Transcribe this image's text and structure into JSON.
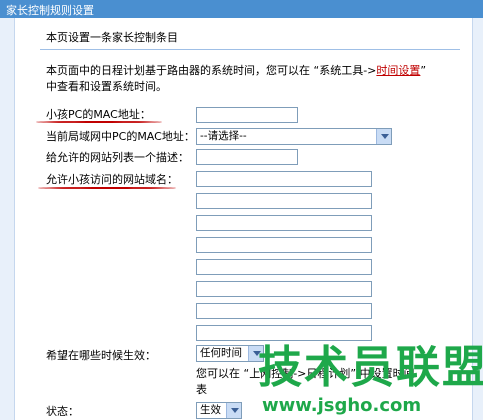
{
  "window": {
    "title": "家长控制规则设置"
  },
  "intro": {
    "heading": "本页设置一条家长控制条目",
    "desc_part1": "本页面中的日程计划基于路由器的系统时间，您可以在 “系统工具->",
    "desc_link": "时间设置",
    "desc_part2": "”",
    "desc_line2": "中查看和设置系统时间。"
  },
  "form": {
    "mac_label": "小孩PC的MAC地址：",
    "mac_value": "",
    "lan_mac_label": "当前局域网中PC的MAC地址：",
    "lan_mac_selected": "--请选择--",
    "site_desc_label": "给允许的网站列表一个描述：",
    "site_desc_value": "",
    "domains_label": "允许小孩访问的网站域名：",
    "domains": [
      "",
      "",
      "",
      "",
      "",
      "",
      "",
      ""
    ],
    "schedule_label": "希望在哪些时候生效：",
    "schedule_selected": "任何时间",
    "schedule_note_line1": "您可以在 “上网控制->日程计划” 中设置时间",
    "schedule_note_line2": "表",
    "status_label": "状态：",
    "status_selected": "生效"
  },
  "watermark": {
    "brand": "技术员联盟",
    "url": "www.jsgho.com"
  },
  "colors": {
    "titlebar": "#4a8fd0",
    "annotation_red": "#c00000",
    "watermark_green": "#1ea84a",
    "input_border": "#7f9db9"
  }
}
